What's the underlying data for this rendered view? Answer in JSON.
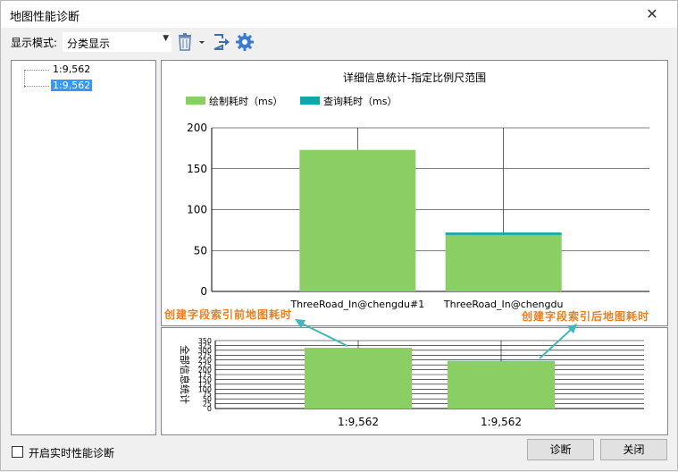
{
  "window": {
    "title": "地图性能诊断",
    "close_glyph": "✕"
  },
  "toolbar": {
    "mode_label": "显示模式:",
    "mode_value": "分类显示",
    "icons": [
      "trash-icon",
      "chevron-down-icon",
      "export-icon",
      "gear-icon"
    ]
  },
  "tree": {
    "items": [
      {
        "label": "1:9,562",
        "selected": false
      },
      {
        "label": "1:9,562",
        "selected": true
      }
    ]
  },
  "colors": {
    "draw": "#8bcf64",
    "query": "#12a6a6",
    "accent": "#3399ff",
    "annotation": "#e67e22",
    "arrow": "#3fb8b8"
  },
  "annotations": {
    "before": "创建字段索引前地图耗时",
    "after": "创建字段索引后地图耗时"
  },
  "footer": {
    "realtime_label": "开启实时性能诊断",
    "diagnose_button": "诊断",
    "close_button": "关闭"
  },
  "chart_data": [
    {
      "type": "bar",
      "stacked": true,
      "title": "详细信息统计-指定比例尺范围",
      "categories": [
        "ThreeRoad_In@chengdu#1",
        "ThreeRoad_In@chengdu"
      ],
      "series": [
        {
          "name": "绘制耗时（ms）",
          "color": "#8bcf64",
          "values": [
            173,
            69
          ]
        },
        {
          "name": "查询耗时（ms）",
          "color": "#12a6a6",
          "values": [
            0,
            3
          ]
        }
      ],
      "ylim": [
        0,
        200
      ],
      "yticks": [
        0,
        50,
        100,
        150,
        200
      ],
      "grid": true,
      "legend": "top-left"
    },
    {
      "type": "bar",
      "stacked": true,
      "ylabel": "全部信息统计",
      "categories": [
        "1:9,562",
        "1:9,562"
      ],
      "series": [
        {
          "color": "#8bcf64",
          "values": [
            310,
            243
          ]
        },
        {
          "color": "#12a6a6",
          "values": [
            2,
            2
          ]
        }
      ],
      "ylim": [
        0,
        350
      ],
      "yticks": [
        0,
        25,
        50,
        75,
        100,
        125,
        150,
        175,
        200,
        225,
        250,
        275,
        300,
        325,
        350
      ],
      "grid": true
    }
  ]
}
